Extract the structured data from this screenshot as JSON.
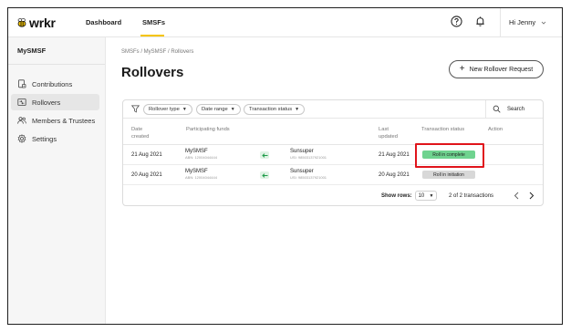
{
  "brand": {
    "name": "wrkr",
    "accent": "#f5c400"
  },
  "topnav": {
    "items": [
      {
        "label": "Dashboard",
        "active": false
      },
      {
        "label": "SMSFs",
        "active": true
      }
    ],
    "help_icon": "help-circle-icon",
    "notification_icon": "bell-icon",
    "user": {
      "greeting": "Hi Jenny"
    }
  },
  "sidebar": {
    "title": "MySMSF",
    "items": [
      {
        "label": "Contributions",
        "icon": "contributions-icon",
        "active": false
      },
      {
        "label": "Rollovers",
        "icon": "rollovers-icon",
        "active": true
      },
      {
        "label": "Members & Trustees",
        "icon": "members-icon",
        "active": false
      },
      {
        "label": "Settings",
        "icon": "gear-icon",
        "active": false
      }
    ]
  },
  "main": {
    "breadcrumb": "SMSFs / MySMSF / Rollovers",
    "title": "Rollovers",
    "new_button": {
      "label": "New Rollover Request"
    },
    "filters": {
      "chips": [
        "Rollover type",
        "Date range",
        "Transaction status"
      ],
      "search_label": "Search"
    },
    "table": {
      "columns": {
        "date_created_1": "Date",
        "date_created_2": "created",
        "participating_funds": "Participating funds",
        "last_updated_1": "Last",
        "last_updated_2": "updated",
        "transaction_status": "Transaction status",
        "action": "Action"
      },
      "rows": [
        {
          "date_created": "21 Aug 2021",
          "from_fund": {
            "name": "MySMSF",
            "abn": "ABN: 12004044444"
          },
          "to_fund": {
            "name": "Sunsuper",
            "usi": "USI: 98503137921001"
          },
          "last_updated": "21 Aug 2021",
          "status": "Roll in complete",
          "status_color": "#6fd38f"
        },
        {
          "date_created": "20 Aug 2021",
          "from_fund": {
            "name": "MySMSF",
            "abn": "ABN: 12004044444"
          },
          "to_fund": {
            "name": "Sunsuper",
            "usi": "USI: 98503137921001"
          },
          "last_updated": "20 Aug 2021",
          "status": "Roll in initiation",
          "status_color": "#d8d8d8"
        }
      ]
    },
    "footer": {
      "show_rows_label": "Show rows:",
      "rows_value": "10",
      "pagination_text": "2 of 2 transactions"
    }
  },
  "highlight_color": "#e0141b"
}
